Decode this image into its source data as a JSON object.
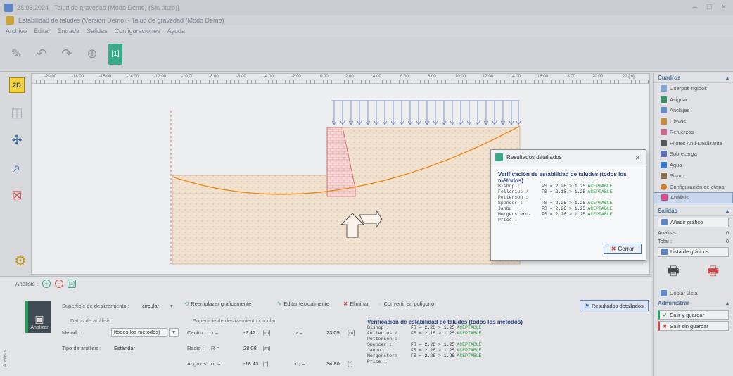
{
  "window": {
    "title": "28.03.2024 · Talud de gravedad (Modo Demo) (Sin título)]",
    "doc_title": "Estabilidad de taludes (Versión Demo) - Talud de gravedad (Modo Demo)"
  },
  "menu": [
    "Archivo",
    "Editar",
    "Entrada",
    "Salidas",
    "Configuraciones",
    "Ayuda"
  ],
  "toolbar": {
    "items": [
      "Editar",
      "Deshacer",
      "Rehacer",
      "Etapa"
    ],
    "stage": "[1]"
  },
  "left_tools": {
    "view": "2D"
  },
  "ruler": [
    "-20.00",
    "-18.00",
    "-16.00",
    "-14.00",
    "-12.00",
    "-10.00",
    "-8.00",
    "-6.00",
    "-4.00",
    "-2.00",
    "0.00",
    "2.00",
    "4.00",
    "6.00",
    "8.00",
    "10.00",
    "12.00",
    "14.00",
    "16.00",
    "18.00",
    "20.00",
    "22 [m]"
  ],
  "right_panel": {
    "header": "Cuadros",
    "items": [
      "Cuerpos rígidos",
      "Asignar",
      "Anclajes",
      "Clavos",
      "Refuerzos",
      "Pilotes Anti-Deslizante",
      "Sobrecarga",
      "Agua",
      "Sismo",
      "Configuración de etapa",
      "Análisis"
    ],
    "salidas": "Salidas",
    "add_graphic": "Añadir gráfico",
    "analysis_label": "Análisis :",
    "analysis_count": "0",
    "total_label": "Total :",
    "total_count": "0",
    "graph_list": "Lista de gráficos",
    "copy_view": "Copiar vista",
    "admin": "Administrar",
    "save_exit": "Salir y guardar",
    "exit_nosave": "Salir sin guardar"
  },
  "dialog": {
    "title": "Resultados detallados",
    "heading": "Verificación de estabilidad de taludes (todos los métodos)",
    "rows": [
      {
        "method": "Bishop :",
        "value": "FS = 2.26 > 1.25",
        "status": "ACEPTABLE"
      },
      {
        "method": "Fellenius / Petterson :",
        "value": "FS = 2.18 > 1.25",
        "status": "ACEPTABLE"
      },
      {
        "method": "Spencer :",
        "value": "FS = 2.26 > 1.25",
        "status": "ACEPTABLE"
      },
      {
        "method": "Janbu :",
        "value": "FS = 2.26 > 1.25",
        "status": "ACEPTABLE"
      },
      {
        "method": "Morgenstern-Price :",
        "value": "FS = 2.26 > 1.25",
        "status": "ACEPTABLE"
      }
    ],
    "close": "Cerrar"
  },
  "bottom": {
    "header": "Análisis :",
    "stage_tag": "[1]",
    "analyze": "Analizar",
    "side_label": "Análisis",
    "slip_label": "Superficie de deslizamiento :",
    "slip_value": "circular",
    "replace": "Reemplazar gráficamente",
    "edit": "Editar textualmente",
    "delete": "Eliminar",
    "convert": "Convertir en polígono",
    "detailed": "Resultados detallados",
    "analysis_data": "Datos de análisis",
    "method_label": "Método :",
    "method_value": "[todos los métodos]",
    "type_label": "Tipo de análisis :",
    "type_value": "Estándar",
    "circ_title": "Superficie de deslizamiento circular",
    "center_label": "Centro :",
    "x_sym": "x =",
    "x_val": "-2.42",
    "z_sym": "z =",
    "z_val": "23.09",
    "unit_m": "[m]",
    "radius_label": "Radio :",
    "r_sym": "R =",
    "r_val": "28.08",
    "angles_label": "Ángulos :",
    "a1_sym": "α₁ =",
    "a1_val": "-18.43",
    "a2_sym": "α₂ =",
    "a2_val": "34.80",
    "unit_deg": "[°]"
  },
  "colors": {
    "accent": "#3aa88a",
    "ok": "#2c9a3d",
    "soil": "#f1e2cf",
    "slip": "#f08a1c",
    "load": "#5b6fb8"
  }
}
